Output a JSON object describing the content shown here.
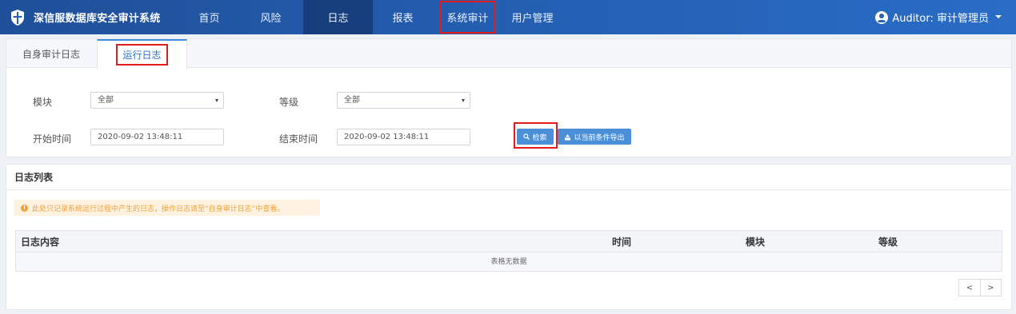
{
  "brand": {
    "title": "深信服数据库安全审计系统",
    "icon": "shield-icon"
  },
  "nav": {
    "items": [
      {
        "label": "首页"
      },
      {
        "label": "风险"
      },
      {
        "label": "日志"
      },
      {
        "label": "报表"
      },
      {
        "label": "系统审计"
      },
      {
        "label": "用户管理"
      }
    ],
    "active": "日志",
    "highlighted": "系统审计"
  },
  "user": {
    "label": "Auditor: 审计管理员",
    "icon": "user-circle-icon"
  },
  "tabs": [
    {
      "label": "自身审计日志"
    },
    {
      "label": "运行日志",
      "active": true
    }
  ],
  "filters": {
    "module_label": "模块",
    "module_value": "全部",
    "level_label": "等级",
    "level_value": "全部",
    "start_label": "开始时间",
    "start_value": "2020-09-02 13:48:11",
    "end_label": "结束时间",
    "end_value": "2020-09-02 13:48:11",
    "search_label": "检索",
    "export_label": "以当前条件导出"
  },
  "list": {
    "title": "日志列表",
    "alert": "此处只记录系统运行过程中产生的日志，操作日志请至“自身审计日志”中查看。",
    "columns": [
      "日志内容",
      "时间",
      "模块",
      "等级"
    ],
    "empty_text": "表格无数据",
    "pager_prev": "<",
    "pager_next": ">"
  },
  "colors": {
    "nav_bg": "#2460b3",
    "accent": "#4a8fd8",
    "highlight": "#e31b1b",
    "alert_text": "#f0a23a"
  }
}
